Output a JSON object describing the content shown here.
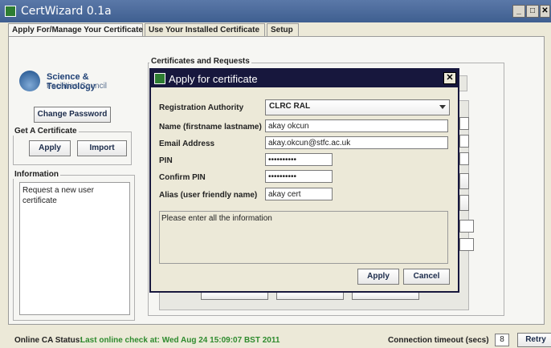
{
  "window": {
    "title": "CertWizard 0.1a"
  },
  "tabs": [
    {
      "label": "Apply For/Manage Your Certificate"
    },
    {
      "label": "Use Your Installed Certificate"
    },
    {
      "label": "Setup"
    }
  ],
  "logo": {
    "line1": "Science & Technology",
    "line2": "Facilities Council"
  },
  "left_panel": {
    "change_password_label": "Change Password",
    "get_cert_group": "Get A Certificate",
    "apply_label": "Apply",
    "import_label": "Import",
    "information_group": "Information",
    "information_text": "Request a new user certificate"
  },
  "main": {
    "certs_group": "Certificates and Requests"
  },
  "dialog": {
    "title": "Apply for certificate",
    "fields": [
      {
        "label": "Registration Authority",
        "value": "CLRC RAL"
      },
      {
        "label": "Name (firstname lastname)",
        "value": "akay okcun"
      },
      {
        "label": "Email Address",
        "value": "akay.okcun@stfc.ac.uk"
      },
      {
        "label": "PIN",
        "value": "••••••••••"
      },
      {
        "label": "Confirm PIN",
        "value": "••••••••••"
      },
      {
        "label": "Alias (user friendly name)",
        "value": "akay cert"
      }
    ],
    "message": "Please enter all the information",
    "apply_label": "Apply",
    "cancel_label": "Cancel"
  },
  "status": {
    "key": "Online CA Status:",
    "value": "Last online check at: Wed Aug 24 15:09:07 BST 2011",
    "timeout_label": "Connection timeout (secs)",
    "timeout_value": "8",
    "retry_label": "Retry"
  }
}
